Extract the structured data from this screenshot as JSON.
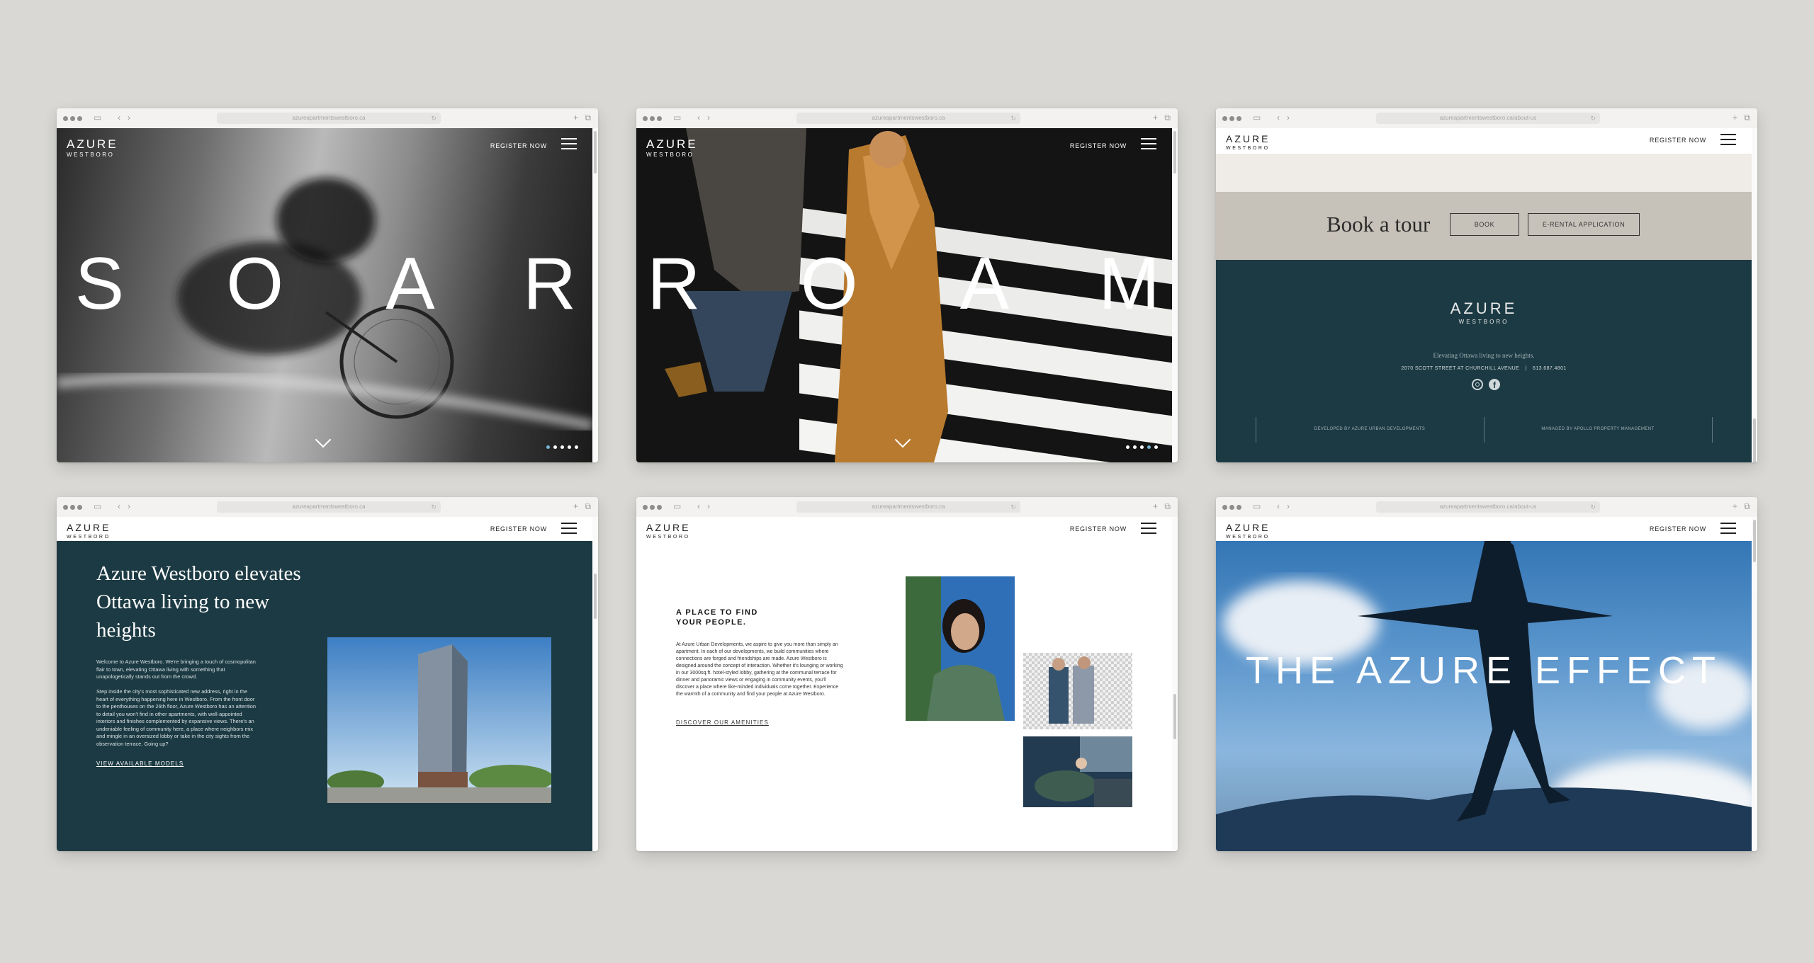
{
  "brand": {
    "name": "AZURE",
    "sub": "WESTBORO"
  },
  "nav": {
    "register": "REGISTER NOW"
  },
  "browser": {
    "url_home": "azureapartmentswestboro.ca",
    "url_contact": "azureapartmentswestboro.ca/about-us"
  },
  "screens": {
    "soar": {
      "word": [
        "S",
        "O",
        "A",
        "R"
      ],
      "slides_active": 1
    },
    "roam": {
      "word": [
        "R",
        "O",
        "A",
        "M"
      ],
      "slides_active": 3
    },
    "tour": {
      "title": "Book a tour",
      "book": "BOOK",
      "erental": "E-RENTAL APPLICATION",
      "tagline": "Elevating Ottawa living to new heights.",
      "address": "2070 SCOTT STREET AT CHURCHILL AVENUE",
      "phone": "613.687.4801",
      "developed": "DEVELOPED BY AZURE URBAN DEVELOPMENTS",
      "managed": "MANAGED BY APOLLO PROPERTY MANAGEMENT",
      "icons": [
        "instagram-icon",
        "facebook-icon"
      ]
    },
    "about": {
      "headline": "Azure Westboro elevates Ottawa living to new heights",
      "p1": "Welcome to Azure Westboro. We're bringing a touch of cosmopolitan flair to town, elevating Ottawa living with something that unapologetically stands out from the crowd.",
      "p2": "Step inside the city's most sophisticated new address, right in the heart of everything happening here in Westboro. From the front door to the penthouses on the 26th floor, Azure Westboro has an attention to detail you won't find in other apartments, with well-appointed interiors and finishes complemented by expansive views. There's an undeniable feeling of community here, a place where neighbors mix and mingle in an oversized lobby or take in the city sights from the observation terrace. Going up?",
      "link": "VIEW AVAILABLE MODELS"
    },
    "people": {
      "heading": "A PLACE TO FIND YOUR PEOPLE.",
      "body": "At Azure Urban Developments, we aspire to give you more than simply an apartment. In each of our developments, we build communities where connections are forged and friendships are made. Azure Westboro is designed around the concept of interaction. Whether it's lounging or working in our 3000sq.ft. hotel-styled lobby, gathering at the communal terrace for dinner and panoramic views or engaging in community events, you'll discover a place where like-minded individuals come together. Experience the warmth of a community and find your people at Azure Westboro.",
      "link": "DISCOVER OUR AMENITIES"
    },
    "effect": {
      "headline": "THE AZURE EFFECT"
    }
  },
  "colors": {
    "teal": "#1c3a43",
    "taupe": "#c7c2b9",
    "cream": "#efece7",
    "bg": "#d9d8d4"
  }
}
